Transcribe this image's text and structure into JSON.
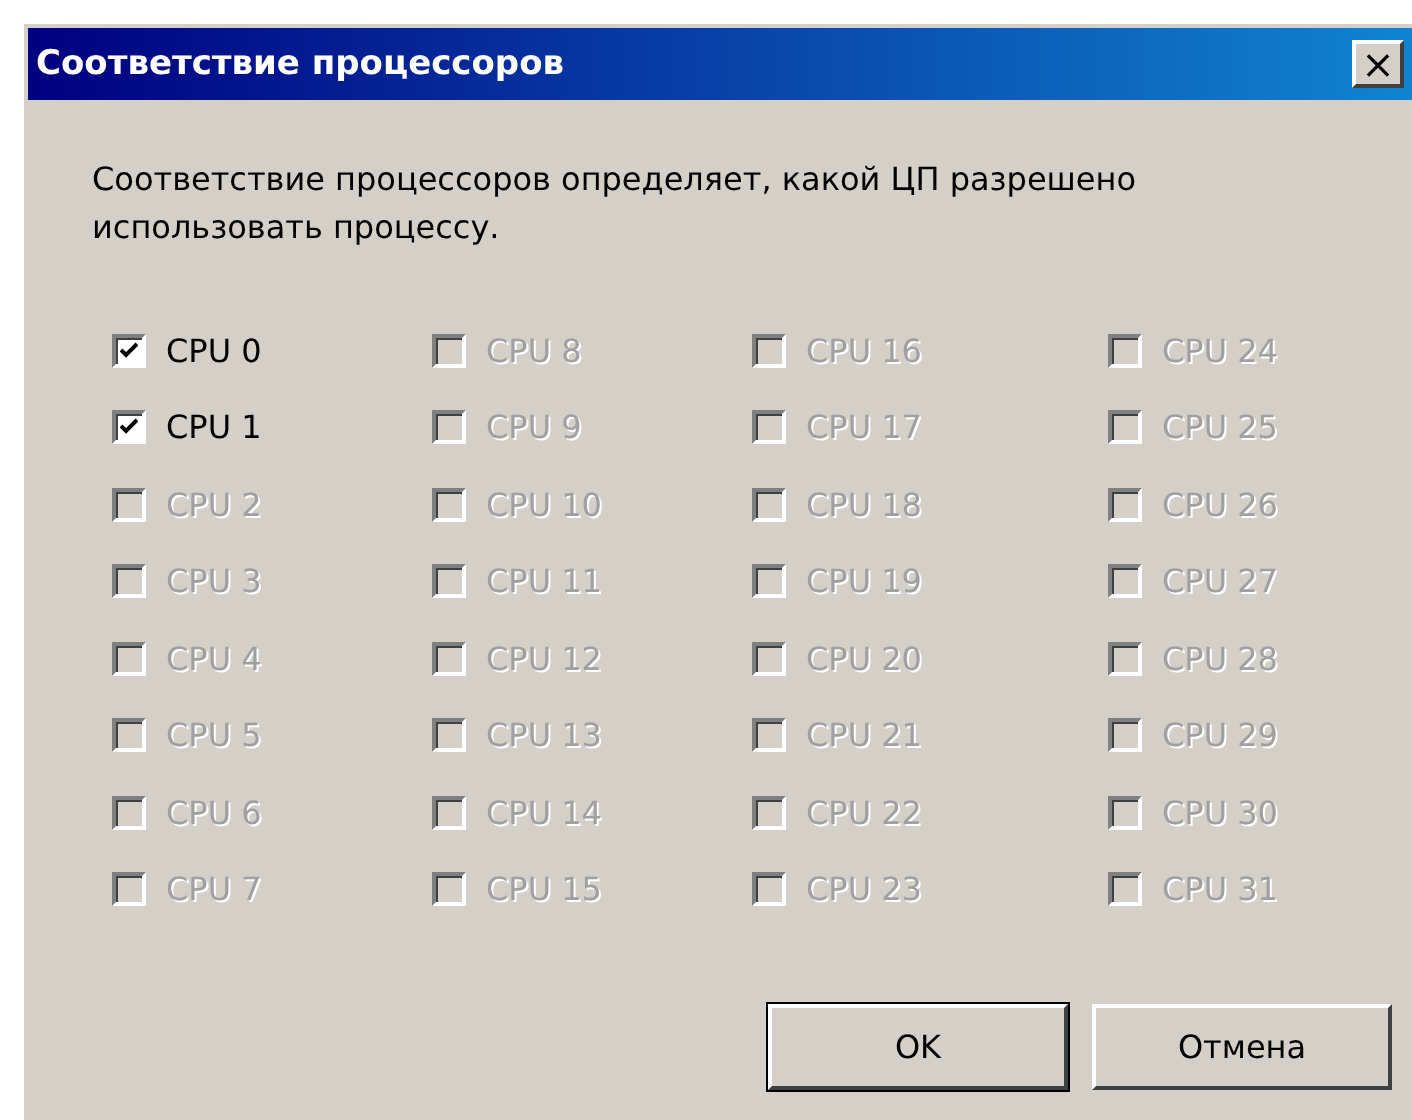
{
  "window": {
    "title": "Соответствие процессоров",
    "close": "×"
  },
  "description": "Соответствие процессоров определяет, какой ЦП разрешено использовать процессу.",
  "cpus": [
    {
      "label": "CPU 0",
      "checked": true,
      "disabled": false
    },
    {
      "label": "CPU 1",
      "checked": true,
      "disabled": false
    },
    {
      "label": "CPU 2",
      "checked": false,
      "disabled": true
    },
    {
      "label": "CPU 3",
      "checked": false,
      "disabled": true
    },
    {
      "label": "CPU 4",
      "checked": false,
      "disabled": true
    },
    {
      "label": "CPU 5",
      "checked": false,
      "disabled": true
    },
    {
      "label": "CPU 6",
      "checked": false,
      "disabled": true
    },
    {
      "label": "CPU 7",
      "checked": false,
      "disabled": true
    },
    {
      "label": "CPU 8",
      "checked": false,
      "disabled": true
    },
    {
      "label": "CPU 9",
      "checked": false,
      "disabled": true
    },
    {
      "label": "CPU 10",
      "checked": false,
      "disabled": true
    },
    {
      "label": "CPU 11",
      "checked": false,
      "disabled": true
    },
    {
      "label": "CPU 12",
      "checked": false,
      "disabled": true
    },
    {
      "label": "CPU 13",
      "checked": false,
      "disabled": true
    },
    {
      "label": "CPU 14",
      "checked": false,
      "disabled": true
    },
    {
      "label": "CPU 15",
      "checked": false,
      "disabled": true
    },
    {
      "label": "CPU 16",
      "checked": false,
      "disabled": true
    },
    {
      "label": "CPU 17",
      "checked": false,
      "disabled": true
    },
    {
      "label": "CPU 18",
      "checked": false,
      "disabled": true
    },
    {
      "label": "CPU 19",
      "checked": false,
      "disabled": true
    },
    {
      "label": "CPU 20",
      "checked": false,
      "disabled": true
    },
    {
      "label": "CPU 21",
      "checked": false,
      "disabled": true
    },
    {
      "label": "CPU 22",
      "checked": false,
      "disabled": true
    },
    {
      "label": "CPU 23",
      "checked": false,
      "disabled": true
    },
    {
      "label": "CPU 24",
      "checked": false,
      "disabled": true
    },
    {
      "label": "CPU 25",
      "checked": false,
      "disabled": true
    },
    {
      "label": "CPU 26",
      "checked": false,
      "disabled": true
    },
    {
      "label": "CPU 27",
      "checked": false,
      "disabled": true
    },
    {
      "label": "CPU 28",
      "checked": false,
      "disabled": true
    },
    {
      "label": "CPU 29",
      "checked": false,
      "disabled": true
    },
    {
      "label": "CPU 30",
      "checked": false,
      "disabled": true
    },
    {
      "label": "CPU 31",
      "checked": false,
      "disabled": true
    }
  ],
  "buttons": [
    {
      "label": "OK",
      "default": true
    },
    {
      "label": "Отмена",
      "default": false
    }
  ]
}
